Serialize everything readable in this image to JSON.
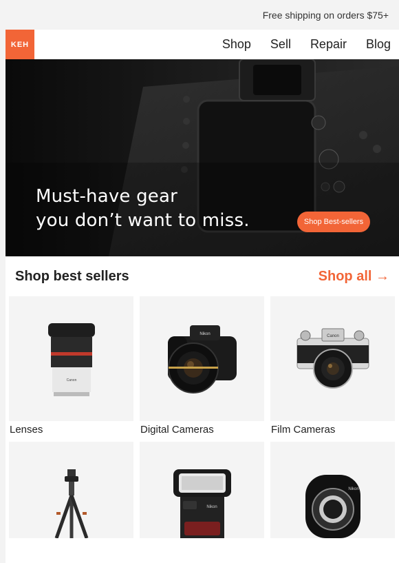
{
  "topbar": {
    "shipping_text": "Free shipping on orders $75+"
  },
  "brand": {
    "logo_text": "KEH",
    "accent": "#f26537"
  },
  "nav": {
    "items": [
      {
        "label": "Shop"
      },
      {
        "label": "Sell"
      },
      {
        "label": "Repair"
      },
      {
        "label": "Blog"
      }
    ]
  },
  "hero": {
    "line1": "Must-have gear",
    "line2": "you don’t want to miss.",
    "cta": "Shop Best-sellers"
  },
  "best_sellers": {
    "title": "Shop best sellers",
    "shop_all": "Shop all →",
    "products": [
      {
        "label": "Lenses",
        "icon": "lens-icon"
      },
      {
        "label": "Digital Cameras",
        "icon": "digital-camera-icon"
      },
      {
        "label": "Film Cameras",
        "icon": "film-camera-icon"
      },
      {
        "label": "",
        "icon": "tripod-icon"
      },
      {
        "label": "",
        "icon": "flash-icon"
      },
      {
        "label": "",
        "icon": "lens-adapter-icon"
      }
    ]
  }
}
